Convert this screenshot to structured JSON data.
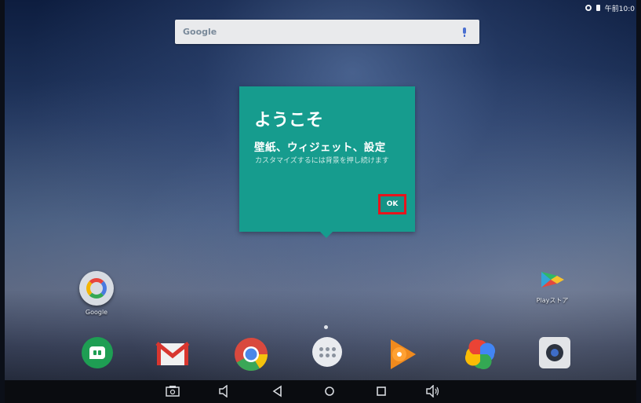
{
  "status_bar": {
    "time": "午前10:0"
  },
  "search": {
    "logo_text": "Google"
  },
  "dialog": {
    "title": "ようこそ",
    "subtitle": "壁紙、ウィジェット、設定",
    "body": "カスタマイズするには背景を押し続けます",
    "ok_label": "OK"
  },
  "desktop": {
    "google_label": "Google",
    "play_store_label": "Playストア"
  },
  "colors": {
    "dialog_bg": "#169c8e",
    "highlight": "#e8141c"
  }
}
